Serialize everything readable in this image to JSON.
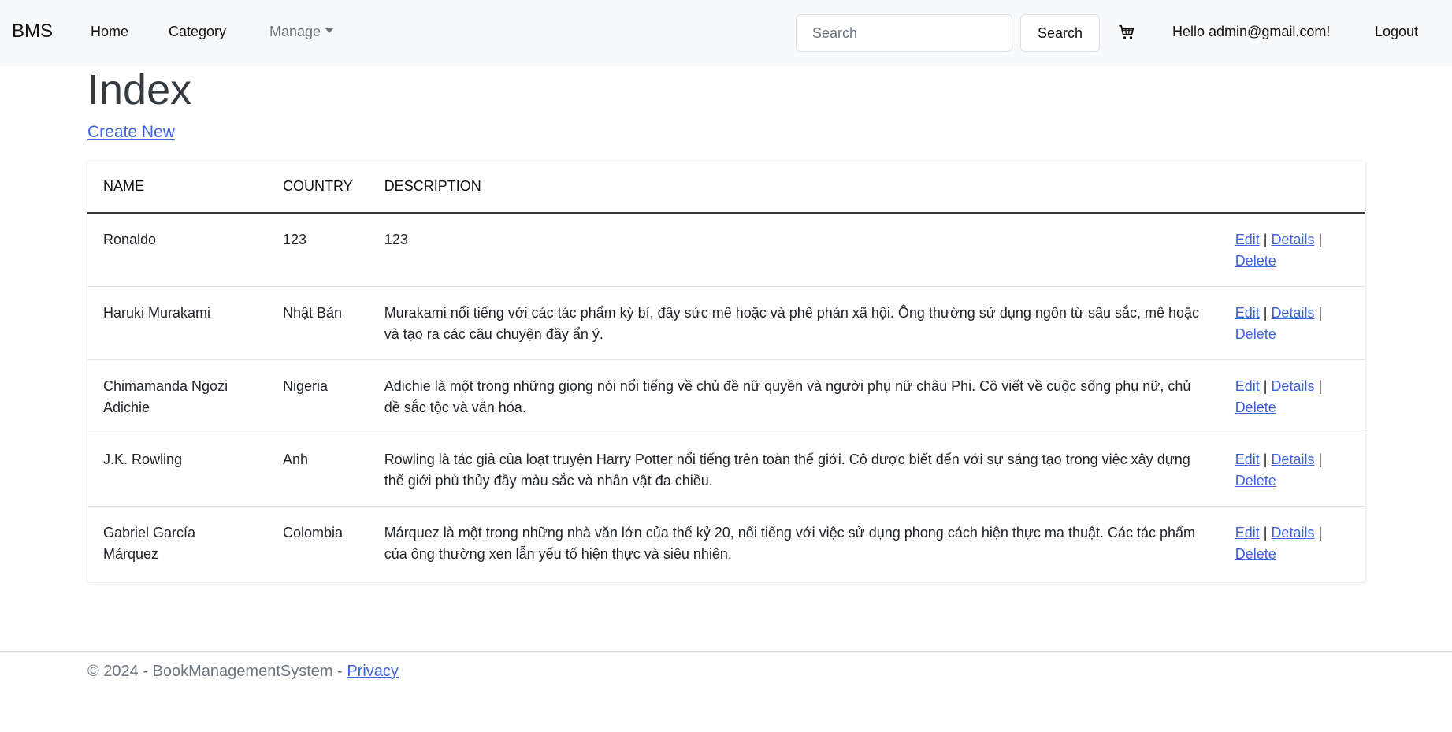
{
  "navbar": {
    "brand": "BMS",
    "home": "Home",
    "category": "Category",
    "manage": "Manage",
    "search_placeholder": "Search",
    "search_button": "Search",
    "greeting": "Hello admin@gmail.com!",
    "logout": "Logout"
  },
  "page": {
    "title": "Index",
    "create_new": "Create New"
  },
  "table": {
    "headers": [
      "NAME",
      "COUNTRY",
      "DESCRIPTION"
    ],
    "rows": [
      {
        "name": "Ronaldo",
        "country": "123",
        "description": "123"
      },
      {
        "name": "Haruki Murakami",
        "country": "Nhật Bản",
        "description": "Murakami nổi tiếng với các tác phẩm kỳ bí, đầy sức mê hoặc và phê phán xã hội. Ông thường sử dụng ngôn từ sâu sắc, mê hoặc và tạo ra các câu chuyện đầy ẩn ý."
      },
      {
        "name": "Chimamanda Ngozi Adichie",
        "country": "Nigeria",
        "description": "Adichie là một trong những giọng nói nổi tiếng về chủ đề nữ quyền và người phụ nữ châu Phi. Cô viết về cuộc sống phụ nữ, chủ đề sắc tộc và văn hóa."
      },
      {
        "name": "J.K. Rowling",
        "country": "Anh",
        "description": "Rowling là tác giả của loạt truyện Harry Potter nổi tiếng trên toàn thế giới. Cô được biết đến với sự sáng tạo trong việc xây dựng thế giới phù thủy đầy màu sắc và nhân vật đa chiều."
      },
      {
        "name": "Gabriel García Márquez",
        "country": "Colombia",
        "description": "Márquez là một trong những nhà văn lớn của thế kỷ 20, nổi tiếng với việc sử dụng phong cách hiện thực ma thuật. Các tác phẩm của ông thường xen lẫn yếu tố hiện thực và siêu nhiên."
      }
    ],
    "actions": {
      "edit": "Edit",
      "details": "Details",
      "delete": "Delete",
      "separator": "|"
    }
  },
  "footer": {
    "text": "© 2024 - BookManagementSystem -",
    "privacy": "Privacy"
  },
  "colors": {
    "link": "#3e63dd",
    "navbar_bg": "#f8f9fa"
  }
}
